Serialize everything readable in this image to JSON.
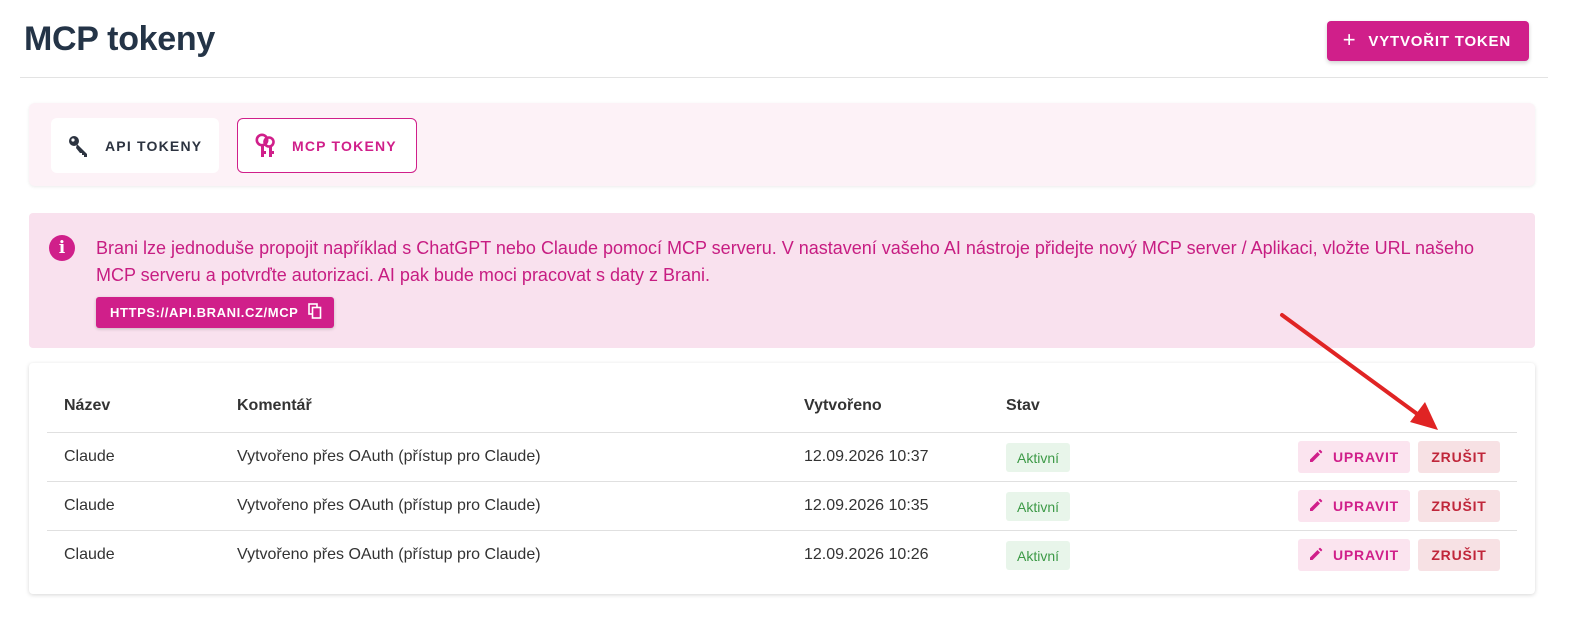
{
  "header": {
    "title": "MCP tokeny",
    "create_button_icon": "plus-icon",
    "create_button_label": "VYTVOŘIT TOKEN"
  },
  "tabs": [
    {
      "label": "API TOKENY",
      "icon": "key-icon",
      "active": false
    },
    {
      "label": "MCP TOKENY",
      "icon": "mcp-keys-icon",
      "active": true
    }
  ],
  "info": {
    "icon": "info-icon",
    "text": "Brani lze jednoduše propojit například s ChatGPT nebo Claude pomocí MCP serveru. V nastavení vašeho AI nástroje přidejte nový MCP server / Aplikaci, vložte URL našeho MCP serveru a potvrďte autorizaci. AI pak bude moci pracovat s daty z Brani.",
    "url_button_label": "HTTPS://API.BRANI.CZ/MCP",
    "url_button_icon": "copy-icon"
  },
  "table": {
    "columns": [
      "Název",
      "Komentář",
      "Vytvořeno",
      "Stav"
    ],
    "rows": [
      {
        "name": "Claude",
        "comment": "Vytvořeno přes OAuth (přístup pro Claude)",
        "created": "12.09.2026 10:37",
        "status": "Aktivní"
      },
      {
        "name": "Claude",
        "comment": "Vytvořeno přes OAuth (přístup pro Claude)",
        "created": "12.09.2026 10:35",
        "status": "Aktivní"
      },
      {
        "name": "Claude",
        "comment": "Vytvořeno přes OAuth (přístup pro Claude)",
        "created": "12.09.2026 10:26",
        "status": "Aktivní"
      }
    ],
    "edit_label": "UPRAVIT",
    "edit_icon": "pencil-icon",
    "cancel_label": "ZRUŠIT"
  },
  "colors": {
    "accent": "#d01f8a",
    "title": "#243447",
    "info_background": "#f9e1ee",
    "status_active": "#3d9a47",
    "cancel": "#c0263a",
    "annotation_arrow": "#e02424"
  }
}
